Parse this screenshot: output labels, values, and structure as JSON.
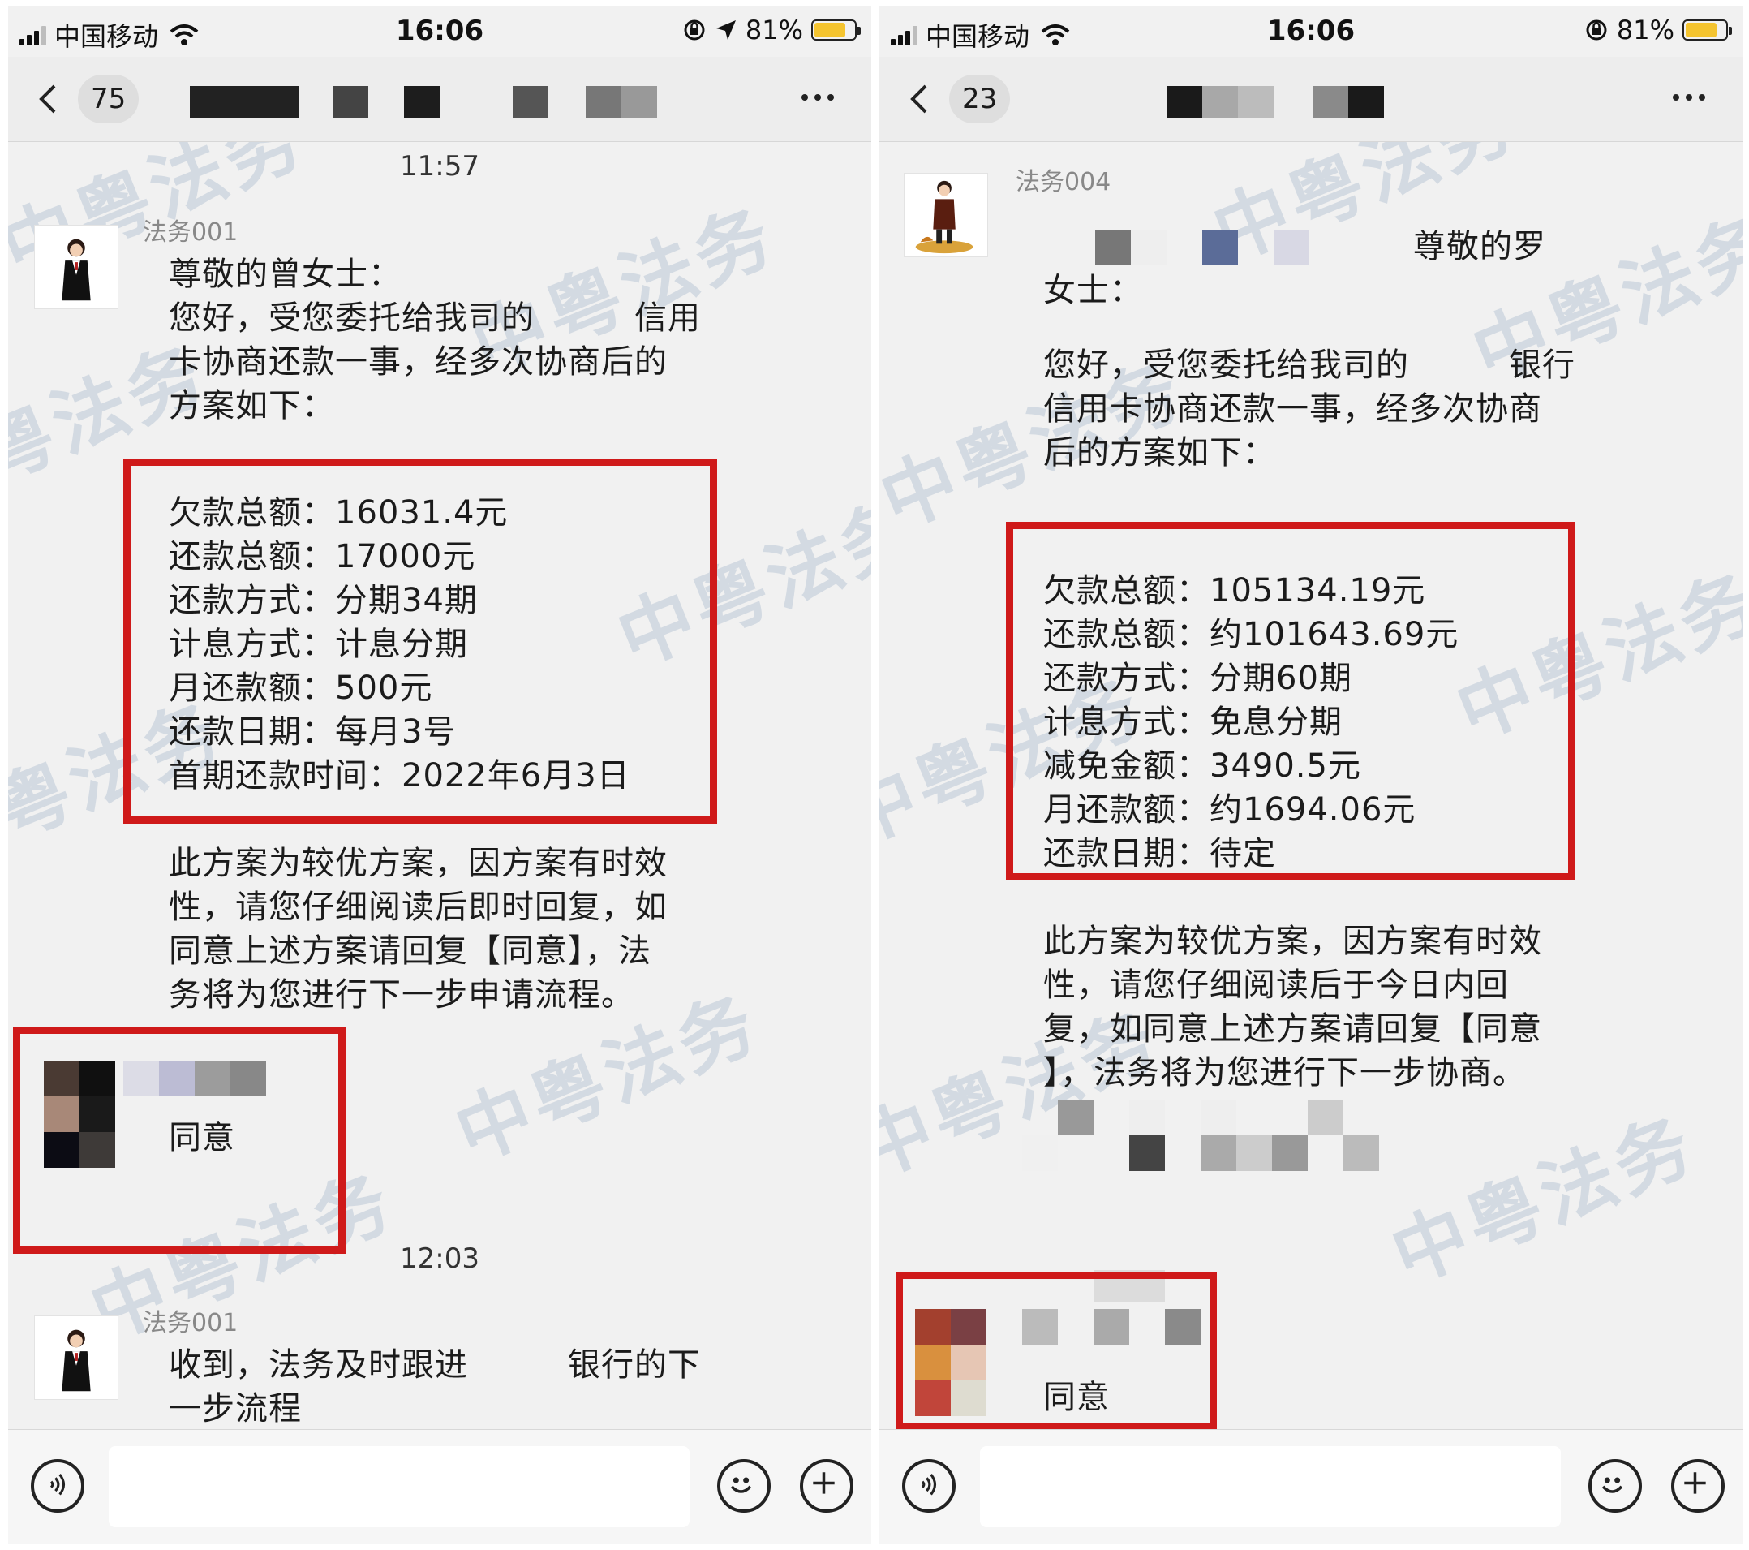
{
  "status": {
    "carrier": "中国移动",
    "time": "16:06",
    "battery_left": "81%",
    "battery_right": "81%",
    "battery_level": 0.81
  },
  "left": {
    "back_count": "75",
    "time1": "11:57",
    "sender1": "法务001",
    "msg1": "尊敬的曾女士：\n您好，受您委托给我司的　　　信用\n卡协商还款一事，经多次协商后的\n方案如下：",
    "plan": [
      "欠款总额：16031.4元",
      "还款总额：17000元",
      "还款方式：分期34期",
      "计息方式：计息分期",
      "月还款额：500元",
      "还款日期：每月3号",
      "首期还款时间：2022年6月3日"
    ],
    "msg2": "此方案为较优方案，因方案有时效\n性，请您仔细阅读后即时回复，如\n同意上述方案请回复【同意】，法\n务将为您进行下一步申请流程。",
    "reply": "同意",
    "time2": "12:03",
    "sender2": "法务001",
    "msg3": "收到，法务及时跟进　　　银行的下\n一步流程"
  },
  "right": {
    "back_count": "23",
    "sender1": "法务004",
    "msg1_head": "尊敬的罗",
    "msg1_tail": "女士：",
    "msg1": "您好，受您委托给我司的　　　银行\n信用卡协商还款一事，经多次协商\n后的方案如下：",
    "plan": [
      "欠款总额：105134.19元",
      "还款总额：约101643.69元",
      "还款方式：分期60期",
      "计息方式：免息分期",
      "减免金额：3490.5元",
      "月还款额：约1694.06元",
      "还款日期：待定"
    ],
    "msg2": "此方案为较优方案，因方案有时效\n性，请您仔细阅读后于今日内回\n复，如同意上述方案请回复【同意\n】，法务将为您进行下一步协商。",
    "reply": "同意"
  },
  "watermark": "中粤法务",
  "colors": {
    "highlight": "#cf1a1a",
    "battery": "#f4c430"
  }
}
